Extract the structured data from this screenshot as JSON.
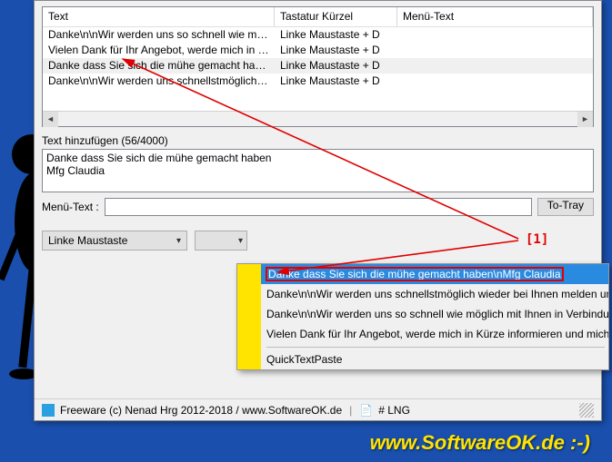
{
  "listview": {
    "columns": {
      "text": "Text",
      "keyboard": "Tastatur Kürzel",
      "menu": "Menü-Text"
    },
    "rows": [
      {
        "text": "Danke\\n\\nWir werden uns so schnell wie möglic...",
        "key": "Linke Maustaste + D",
        "menu": ""
      },
      {
        "text": "Vielen Dank für Ihr Angebot, werde mich in Kürze...",
        "key": "Linke Maustaste + D",
        "menu": ""
      },
      {
        "text": "Danke dass Sie sich die mühe gemacht haben\\n...",
        "key": "Linke Maustaste + D",
        "menu": ""
      },
      {
        "text": "Danke\\n\\nWir werden uns schnellstmöglich wied...",
        "key": "Linke Maustaste + D",
        "menu": ""
      }
    ]
  },
  "add_text": {
    "label": "Text hinzufügen (56/4000)",
    "value": "Danke dass Sie sich die mühe gemacht haben\nMfg Claudia"
  },
  "menu_text_label": "Menü-Text :",
  "menu_text_value": "",
  "to_tray_label": "To-Tray",
  "combo_value": "Linke Maustaste",
  "popup": {
    "items": [
      "Danke dass Sie sich die mühe gemacht haben\\nMfg Claudia",
      "Danke\\n\\nWir werden uns schnellstmöglich wieder bei Ihnen melden und Sie",
      "Danke\\n\\nWir werden uns so schnell wie möglich mit Ihnen in Verbindung se",
      "Vielen Dank für Ihr Angebot, werde mich in Kürze informieren und mich dann"
    ],
    "app_name": "QuickTextPaste"
  },
  "status": {
    "freeware": "Freeware (c) Nenad Hrg 2012-2018 / www.SoftwareOK.de",
    "lang": "# LNG"
  },
  "annotation": "[1]",
  "footer_url": "www.SoftwareOK.de :-)"
}
